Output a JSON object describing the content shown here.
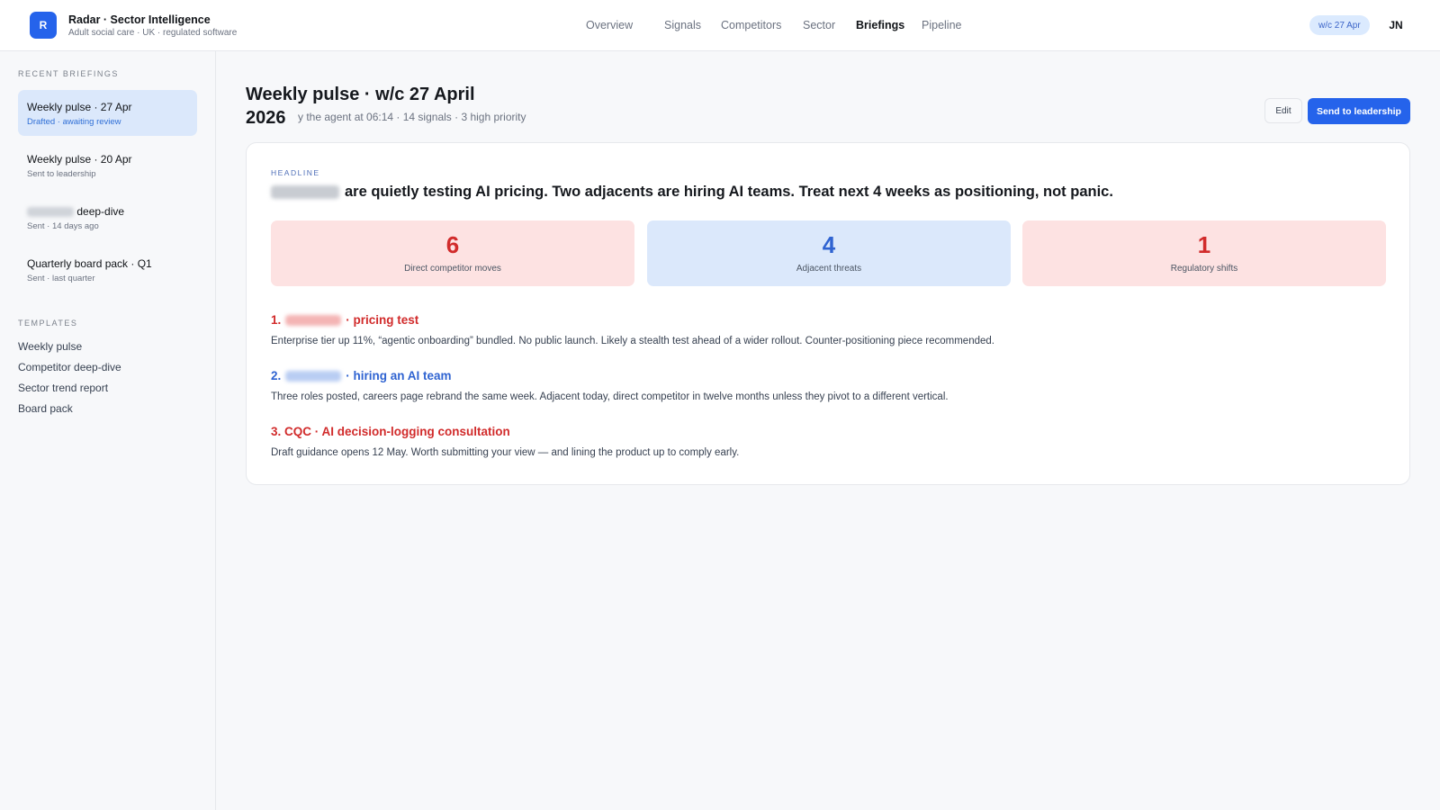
{
  "app": {
    "logo_letter": "R",
    "title": "Radar · Sector Intelligence",
    "subtitle": "Adult social care · UK · regulated software"
  },
  "nav": {
    "overview": "Overview",
    "signals": "Signals",
    "competitors": "Competitors",
    "sector": "Sector",
    "briefings": "Briefings",
    "pipeline": "Pipeline",
    "active": "Briefings"
  },
  "header_right": {
    "week_pill": "w/c 27 Apr",
    "avatar_initials": "JN"
  },
  "sidebar": {
    "recent_heading": "RECENT BRIEFINGS",
    "briefings": [
      {
        "title": "Weekly pulse · 27 Apr",
        "sub": "Drafted · awaiting review",
        "active": true
      },
      {
        "title": "Weekly pulse · 20 Apr",
        "sub": "Sent to leadership"
      },
      {
        "title": "deep-dive",
        "sub": "Sent · 14 days ago"
      },
      {
        "title": "Quarterly board pack · Q1",
        "sub": "Sent · last quarter"
      }
    ],
    "templates_heading": "TEMPLATES",
    "templates": [
      "Weekly pulse",
      "Competitor deep-dive",
      "Sector trend report",
      "Board pack"
    ]
  },
  "page": {
    "title": "Weekly pulse · w/c 27 April 2026",
    "meta": "y the agent at 06:14 · 14 signals · 3 high priority",
    "edit_label": "Edit",
    "send_label": "Send to leadership"
  },
  "card": {
    "headline_label": "HEADLINE",
    "headline": "are quietly testing AI pricing. Two adjacents are hiring AI teams. Treat next 4 weeks as positioning, not panic.",
    "stats": [
      {
        "value": "6",
        "label": "Direct competitor moves",
        "tone": "red"
      },
      {
        "value": "4",
        "label": "Adjacent threats",
        "tone": "blue"
      },
      {
        "value": "1",
        "label": "Regulatory shifts",
        "tone": "red"
      }
    ],
    "items": [
      {
        "num": "1.",
        "title": "· pricing test",
        "desc": "Enterprise tier up 11%, “agentic onboarding” bundled. No public launch. Likely a stealth test ahead of a wider rollout. Counter-positioning piece recommended."
      },
      {
        "num": "2.",
        "title": "· hiring an AI team",
        "desc": "Three roles posted, careers page rebrand the same week. Adjacent today, direct competitor in twelve months unless they pivot to a different vertical."
      },
      {
        "num": "3.",
        "title": "CQC · AI decision-logging consultation",
        "desc": "Draft guidance opens 12 May. Worth submitting your view — and lining the product up to comply early."
      }
    ]
  },
  "colors": {
    "accent": "#2563eb",
    "danger": "#d12b2b",
    "info": "#2f63d1",
    "danger_bg": "#fde2e2",
    "info_bg": "#dbe8fb"
  }
}
